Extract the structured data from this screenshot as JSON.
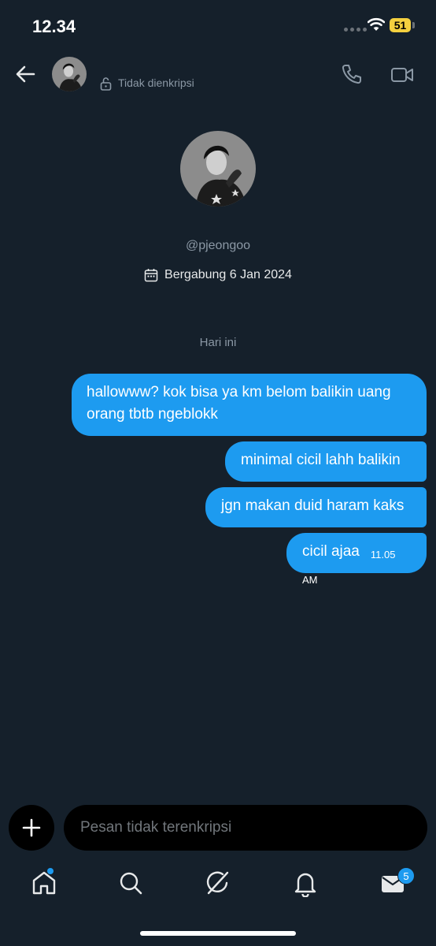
{
  "status_bar": {
    "time": "12.34",
    "battery": "51"
  },
  "header": {
    "encryption_label": "Tidak dienkripsi"
  },
  "profile": {
    "handle": "@pjeongoo",
    "joined": "Bergabung 6 Jan 2024"
  },
  "conversation": {
    "date_divider": "Hari ini",
    "messages": [
      {
        "text": "hallowww? kok bisa ya km belom balikin uang orang tbtb ngeblokk"
      },
      {
        "text": "minimal cicil lahh balikin"
      },
      {
        "text": "jgn makan duid haram kaks"
      },
      {
        "text": "cicil ajaa",
        "time": "11.05 AM"
      }
    ]
  },
  "composer": {
    "placeholder": "Pesan tidak terenkripsi"
  },
  "bottom_nav": {
    "items": [
      "home-icon",
      "search-icon",
      "grok-icon",
      "notifications-icon",
      "messages-icon"
    ],
    "messages_badge": "5"
  },
  "colors": {
    "background": "#15202b",
    "accent": "#1d9bf0",
    "muted_text": "#8b98a5"
  }
}
